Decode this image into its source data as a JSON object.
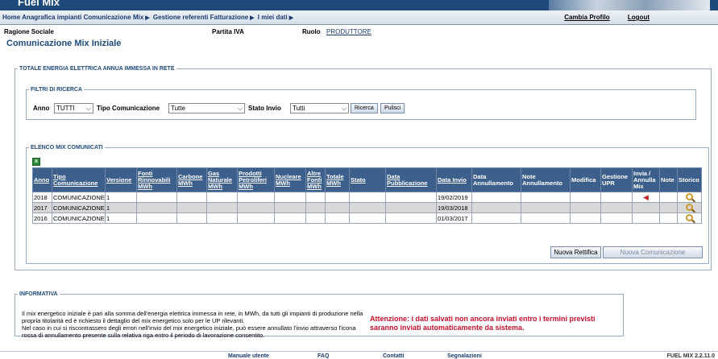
{
  "app": {
    "title": "Fuel Mix"
  },
  "breadcrumb": {
    "items": [
      "Home Anagrafica impianti Comunicazione Mix",
      "Gestione referenti Fatturazione",
      "I miei dati"
    ]
  },
  "top_links": {
    "change_profile": "Cambia Profilo",
    "logout": "Logout"
  },
  "info": {
    "ragione_sociale_label": "Ragione Sociale",
    "partita_iva_label": "Partita IVA",
    "ruolo_label": "Ruolo",
    "ruolo_value": "PRODUTTORE"
  },
  "page_title": "Comunicazione Mix Iniziale",
  "main_box": {
    "legend": "TOTALE ENERGIA ELETTRICA ANNUA IMMESSA IN RETE"
  },
  "filters": {
    "legend": "FILTRI DI RICERCA",
    "anno_label": "Anno",
    "anno_value": "TUTTI",
    "tipo_label": "Tipo Comunicazione",
    "tipo_value": "Tutte",
    "stato_label": "Stato Invio",
    "stato_value": "Tutti",
    "search_button": "Ricerca",
    "clear_button": "Pulisci"
  },
  "list": {
    "legend": "ELENCO MIX COMUNICATI",
    "columns": [
      "Anno",
      "Tipo Comunicazione",
      "Versione",
      "Fonti Rinnovabili MWh",
      "Carbone MWh",
      "Gas Naturale MWh",
      "Prodotti Petroliferi MWh",
      "Nucleare MWh",
      "Altre Fonti MWh",
      "Totale MWh",
      "Stato",
      "Data Pubblicazione",
      "Data Invio",
      "Data Annullamento",
      "Note Annullamento",
      "Modifica",
      "Gestione UPR",
      "Invia / Annulla Mix",
      "Note",
      "Storico"
    ],
    "rows": [
      {
        "anno": "2018",
        "tipo": "COMUNICAZIONE",
        "versione": "1",
        "data_invio": "19/02/2019",
        "has_cancel": true
      },
      {
        "anno": "2017",
        "tipo": "COMUNICAZIONE",
        "versione": "1",
        "data_invio": "19/03/2018",
        "has_cancel": false
      },
      {
        "anno": "2016",
        "tipo": "COMUNICAZIONE",
        "versione": "1",
        "data_invio": "01/03/2017",
        "has_cancel": false
      }
    ]
  },
  "actions": {
    "rettifica": "Nuova Rettifica",
    "comunicazione": "Nuova Comunicazione"
  },
  "informativa": {
    "legend": "INFORMATIVA",
    "line1": "Il mix energetico iniziale è pari alla somma dell'energia elettrica immessa in rete, in MWh, da tutti gli impianti di produzione nella propria titolarità ed è richiesto il dettaglio del mix energetico solo per le UP rilevanti.",
    "line2": "Nel caso in cui si riscontrassero degli errori nell'invio del mix energetico iniziale, può essere annullato l'invio attraverso l'icona rossa di annullamento presente sulla relativa riga entro il periodo di lavorazione consentito.",
    "warning": "Attenzione: i dati salvati non ancora inviati entro i termini previsti saranno inviati automaticamente da sistema."
  },
  "footer": {
    "manuale": "Manuale utente",
    "faq": "FAQ",
    "contatti": "Contatti",
    "segnalazioni": "Segnalazioni",
    "version": "FUEL MIX 2.2.11.0"
  }
}
